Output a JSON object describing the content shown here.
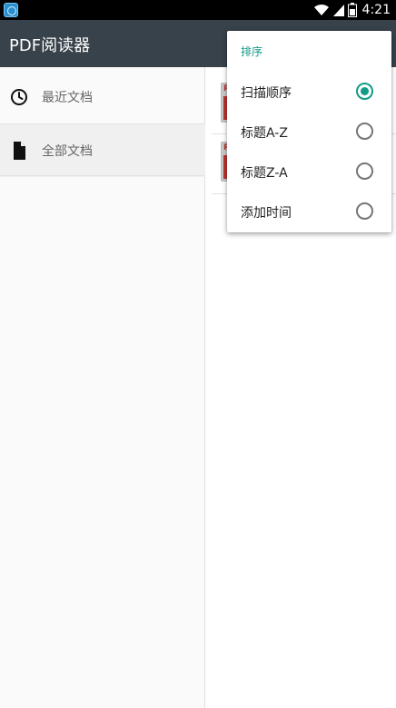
{
  "status_bar": {
    "time": "4:21",
    "icons": [
      "app-notification-icon",
      "wifi-icon",
      "cell-signal-icon",
      "battery-icon"
    ]
  },
  "toolbar": {
    "title": "PDF阅读器"
  },
  "drawer": {
    "items": [
      {
        "label": "最近文档",
        "icon": "clock-icon",
        "selected": false
      },
      {
        "label": "全部文档",
        "icon": "document-icon",
        "selected": true
      }
    ]
  },
  "content": {
    "thumb_text": "P"
  },
  "sort_menu": {
    "header": "排序",
    "options": [
      {
        "label": "扫描顺序",
        "checked": true
      },
      {
        "label": "标题A-Z",
        "checked": false
      },
      {
        "label": "标题Z-A",
        "checked": false
      },
      {
        "label": "添加时间",
        "checked": false
      }
    ]
  },
  "colors": {
    "toolbar": "#37424b",
    "accent": "#129b86",
    "pdf_red": "#b8342f"
  }
}
